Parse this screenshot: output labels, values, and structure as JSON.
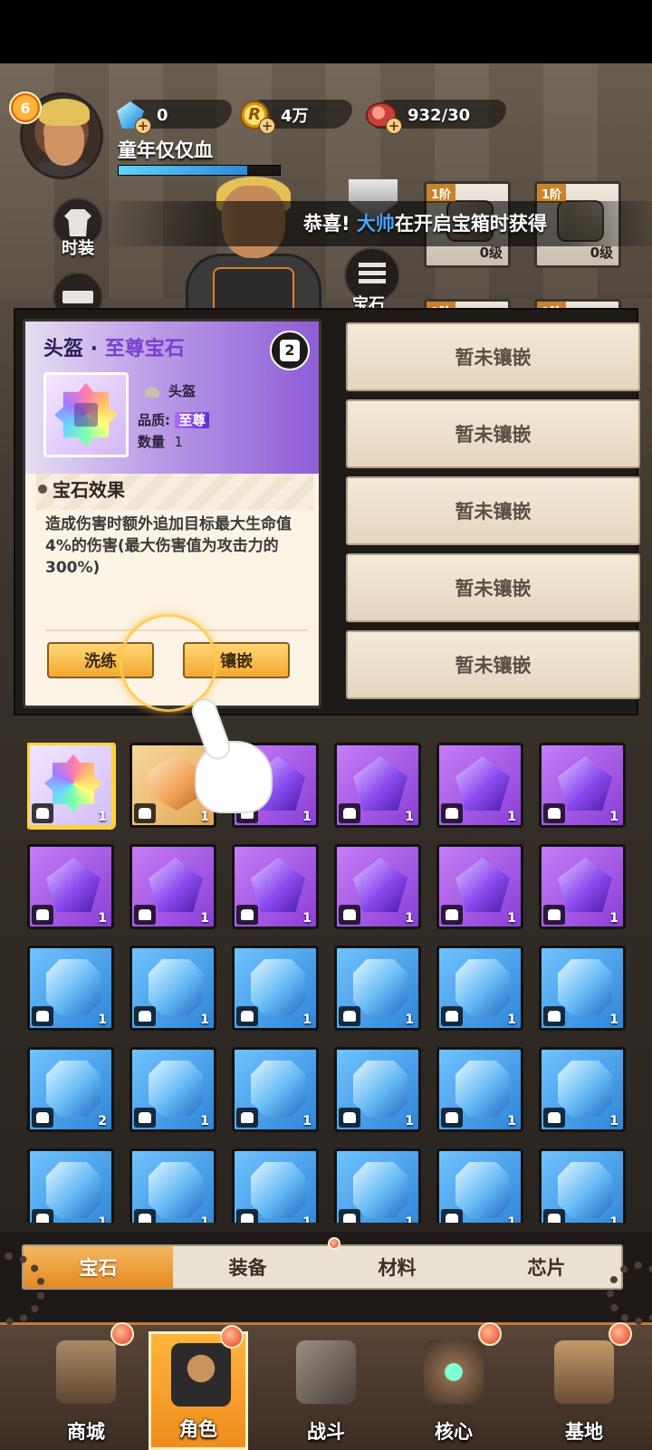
{
  "player": {
    "level": "6",
    "name": "童年仅仅血",
    "exp_fraction": 0.8
  },
  "resources": [
    {
      "id": "diamond",
      "icon": "diamond-icon",
      "value": "0"
    },
    {
      "id": "coin",
      "icon": "r-coin-icon",
      "glyph": "R",
      "value": "4万"
    },
    {
      "id": "stamina",
      "icon": "meat-icon",
      "value": "932/30"
    }
  ],
  "side_buttons": {
    "fashion": "时装",
    "gem": "宝石"
  },
  "announcement": {
    "prefix": "恭喜!",
    "name": "大帅",
    "suffix": "在开启宝箱时获得"
  },
  "equip_slots": [
    {
      "tier": "1阶",
      "level": "0级"
    },
    {
      "tier": "1阶",
      "level": "0级"
    },
    {
      "tier": "1阶"
    },
    {
      "tier": "1阶"
    }
  ],
  "sockets": [
    "暂未镶嵌",
    "暂未镶嵌",
    "暂未镶嵌",
    "暂未镶嵌",
    "暂未镶嵌"
  ],
  "popup": {
    "title_part": "头盔",
    "title_sep": " · ",
    "title_accent": "至尊宝石",
    "close_glyph": "2",
    "slot_name": "头盔",
    "quality_label": "品质: ",
    "quality_value": "至尊",
    "quantity_label": "数量",
    "quantity_value": "1",
    "effect_title": "宝石效果",
    "effect_text": "造成伤害时额外追加目标最大生命值4%的伤害(最大伤害值为攻击力的300%)",
    "btn_refine": "洗练",
    "btn_inlay": "镶嵌"
  },
  "inventory": [
    {
      "kind": "rainbow",
      "count": "1",
      "selected": true
    },
    {
      "kind": "orange",
      "count": "1"
    },
    {
      "kind": "purple",
      "count": "1"
    },
    {
      "kind": "purple",
      "count": "1"
    },
    {
      "kind": "purple",
      "count": "1"
    },
    {
      "kind": "purple",
      "count": "1"
    },
    {
      "kind": "purple",
      "count": "1"
    },
    {
      "kind": "purple",
      "count": "1"
    },
    {
      "kind": "purple",
      "count": "1"
    },
    {
      "kind": "purple",
      "count": "1"
    },
    {
      "kind": "purple",
      "count": "1"
    },
    {
      "kind": "purple",
      "count": "1"
    },
    {
      "kind": "blue",
      "count": "1"
    },
    {
      "kind": "blue",
      "count": "1"
    },
    {
      "kind": "blue",
      "count": "1"
    },
    {
      "kind": "blue",
      "count": "1"
    },
    {
      "kind": "blue",
      "count": "1"
    },
    {
      "kind": "blue",
      "count": "1"
    },
    {
      "kind": "blue",
      "count": "2"
    },
    {
      "kind": "blue",
      "count": "1"
    },
    {
      "kind": "blue",
      "count": "1"
    },
    {
      "kind": "blue",
      "count": "1"
    },
    {
      "kind": "blue",
      "count": "1"
    },
    {
      "kind": "blue",
      "count": "1"
    },
    {
      "kind": "blue",
      "count": "1"
    },
    {
      "kind": "blue",
      "count": "1"
    },
    {
      "kind": "blue",
      "count": "1"
    },
    {
      "kind": "blue",
      "count": "1"
    },
    {
      "kind": "blue",
      "count": "1"
    },
    {
      "kind": "blue",
      "count": "1"
    }
  ],
  "category_tabs": [
    {
      "label": "宝石",
      "active": true
    },
    {
      "label": "装备"
    },
    {
      "label": "材料",
      "alert": true
    },
    {
      "label": "芯片"
    }
  ],
  "bottom_nav": [
    {
      "label": "商城",
      "alert": true
    },
    {
      "label": "角色",
      "active": true,
      "alert": true
    },
    {
      "label": "战斗"
    },
    {
      "label": "核心",
      "alert": true
    },
    {
      "label": "基地",
      "alert": true
    }
  ],
  "colors": {
    "accent": "#f08d1c",
    "announce_highlight": "#4aa3ff",
    "purple_gem": "#8a3fd6",
    "blue_gem": "#2f84d8"
  }
}
